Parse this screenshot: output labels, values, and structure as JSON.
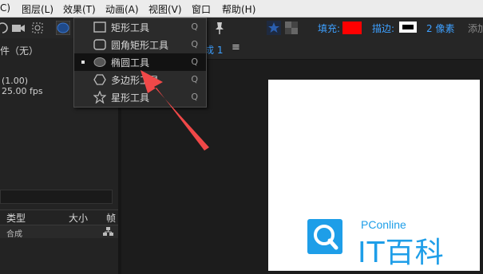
{
  "menubar": {
    "items": [
      "C)",
      "图层(L)",
      "效果(T)",
      "动画(A)",
      "视图(V)",
      "窗口",
      "帮助(H)"
    ]
  },
  "toolbar": {
    "fill_label": "填充:",
    "stroke_label": "描边:",
    "stroke_width": "2 像素",
    "add_label": "添加",
    "fill_color": "#ff0000"
  },
  "tool_menu": {
    "items": [
      {
        "label": "矩形工具",
        "key": "Q",
        "icon": "rectangle-icon"
      },
      {
        "label": "圆角矩形工具",
        "key": "Q",
        "icon": "rounded-rectangle-icon"
      },
      {
        "label": "椭圆工具",
        "key": "Q",
        "icon": "ellipse-icon",
        "selected": true
      },
      {
        "label": "多边形工具",
        "key": "Q",
        "icon": "polygon-icon"
      },
      {
        "label": "星形工具",
        "key": "Q",
        "icon": "star-icon"
      }
    ]
  },
  "project_panel": {
    "title": "件（无）",
    "ratio": "(1.00)",
    "fps": "25.00 fps",
    "columns": [
      "类型",
      "大小",
      "帧"
    ],
    "row_type": "合成"
  },
  "composition": {
    "tab_label": "成 1",
    "menu_glyph": "≡"
  },
  "watermark": {
    "brand_small": "PConline",
    "brand_big": "IT百科"
  },
  "annotation": {
    "arrow_color": "#f04848"
  }
}
